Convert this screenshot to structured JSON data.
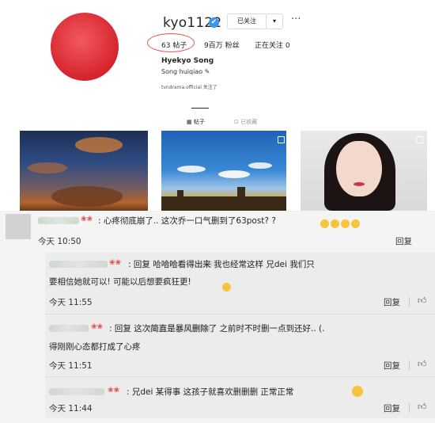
{
  "profile": {
    "username": "kyo1122",
    "verified_icon": "✔",
    "follow_label": "已关注",
    "follow_caret": "▾",
    "more_label": "···",
    "posts": "63 帖子",
    "followers": "9百万 粉丝",
    "following": "正在关注 0",
    "display_name": "Hyekyo Song",
    "bio": "Song huiqiao ✎",
    "bio_link": "tvndrama.official 关注了",
    "tabs": [
      {
        "label": "▦ 帖子",
        "active": true
      },
      {
        "label": "⊡ 已收藏",
        "active": false
      }
    ]
  },
  "comments": [
    {
      "text": ": 心疼彻底崩了.. 这次乔一口气删到了63post? ?",
      "time": "今天 10:50",
      "reply_label": "回复"
    },
    {
      "text_line1": ": 回复              哈哈哈看得出来 我也经常这样   兄dei 我们只",
      "text_line2": "要相信她就可以! 可能以后想要疯狂更!",
      "time": "今天 11:55",
      "reply_label": "回复"
    },
    {
      "text_line1": ": 回复              这次简直是暴风删除了 之前时不时删一点到还好..  (.",
      "text_line2": "得刚刚心态都打成了心疼",
      "time": "今天 11:51",
      "reply_label": "回复"
    },
    {
      "text": ": 兄dei 某得事 这孩子就喜欢删删删 正常正常",
      "time": "今天 11:44",
      "reply_label": "回复"
    }
  ],
  "colors": {
    "verified": "#3897f0",
    "highlight_circle": "#e05555",
    "avatar_red": "#d8232d"
  }
}
